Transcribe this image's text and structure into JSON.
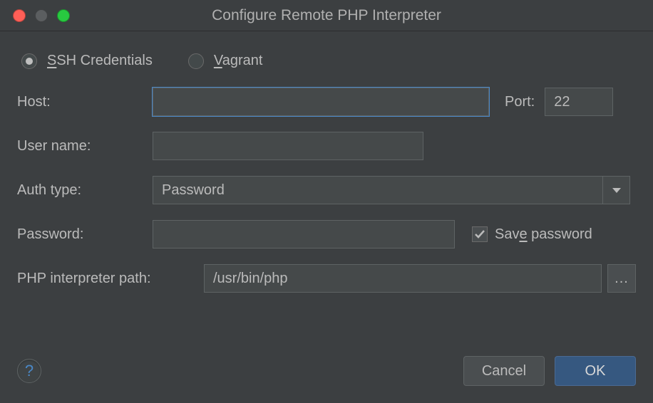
{
  "window": {
    "title": "Configure Remote PHP Interpreter"
  },
  "mode": {
    "ssh": {
      "pre": "",
      "u": "S",
      "post": "SH Credentials",
      "selected": true
    },
    "vagrant": {
      "pre": "",
      "u": "V",
      "post": "agrant",
      "selected": false
    }
  },
  "host": {
    "label": "Host:",
    "value": ""
  },
  "port": {
    "label": "Port:",
    "value": "22"
  },
  "user": {
    "label": "User name:",
    "value": ""
  },
  "auth": {
    "label": "Auth type:",
    "value": "Password"
  },
  "password": {
    "label": "Password:",
    "value": ""
  },
  "save_pw": {
    "pre": "Sav",
    "u": "e",
    "post": " password",
    "checked": true
  },
  "path": {
    "label": "PHP interpreter path:",
    "value": "/usr/bin/php"
  },
  "browse": {
    "label": "..."
  },
  "help": {
    "label": "?"
  },
  "buttons": {
    "cancel": "Cancel",
    "ok": "OK"
  }
}
